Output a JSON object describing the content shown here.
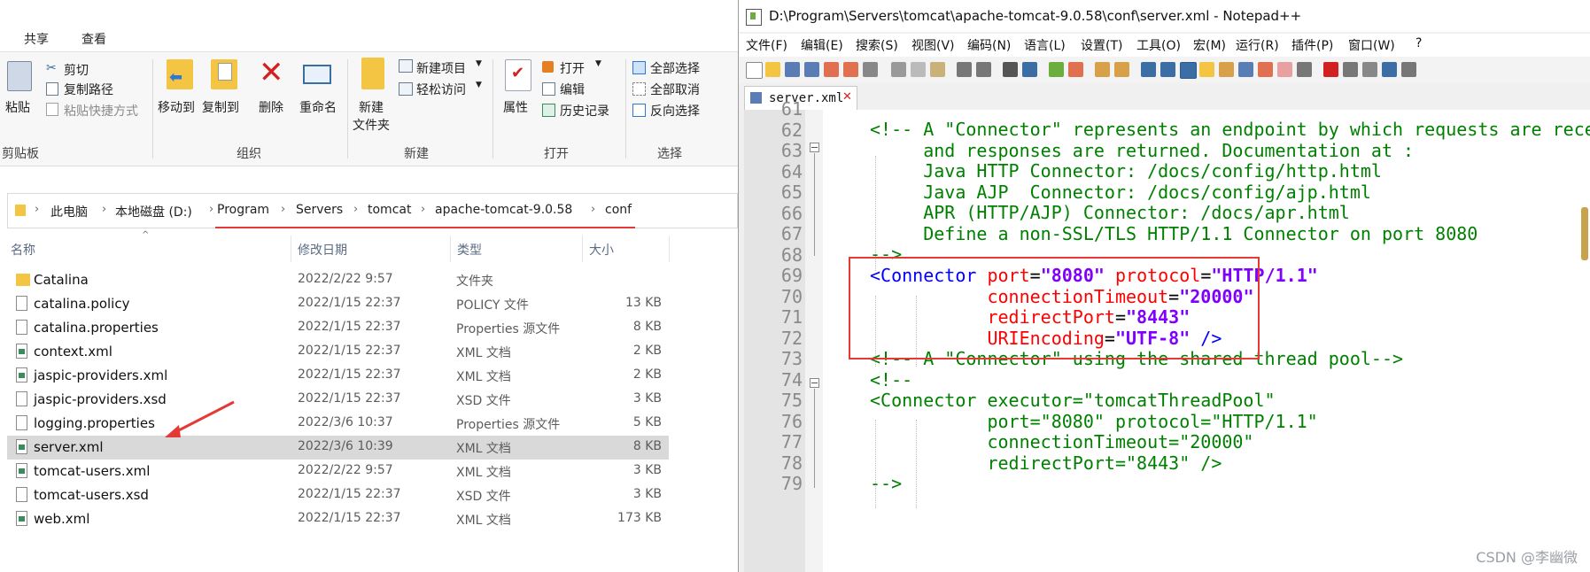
{
  "explorer": {
    "tabs": [
      "共享",
      "查看"
    ],
    "ribbon": {
      "paste": "粘贴",
      "cut": "剪切",
      "copy_path": "复制路径",
      "paste_shortcut": "粘贴快捷方式",
      "clipboard": "剪贴板",
      "move_to": "移动到",
      "copy_to": "复制到",
      "delete": "删除",
      "rename": "重命名",
      "organize": "组织",
      "new_folder_1": "新建",
      "new_folder_2": "文件夹",
      "new_item": "新建项目",
      "easy_access": "轻松访问",
      "new_group": "新建",
      "properties": "属性",
      "open": "打开",
      "edit": "编辑",
      "history": "历史记录",
      "open_group": "打开",
      "select_all": "全部选择",
      "select_none": "全部取消",
      "invert_select": "反向选择",
      "select_group": "选择"
    },
    "breadcrumb": [
      "此电脑",
      "本地磁盘 (D:)",
      "Program",
      "Servers",
      "tomcat",
      "apache-tomcat-9.0.58",
      "conf"
    ],
    "columns": {
      "name": "名称",
      "modified": "修改日期",
      "type": "类型",
      "size": "大小"
    },
    "files": [
      {
        "name": "Catalina",
        "date": "2022/2/22 9:57",
        "type": "文件夹",
        "size": "",
        "icon": "folder-icon"
      },
      {
        "name": "catalina.policy",
        "date": "2022/1/15 22:37",
        "type": "POLICY 文件",
        "size": "13 KB",
        "icon": "file-icon"
      },
      {
        "name": "catalina.properties",
        "date": "2022/1/15 22:37",
        "type": "Properties 源文件",
        "size": "8 KB",
        "icon": "file-icon"
      },
      {
        "name": "context.xml",
        "date": "2022/1/15 22:37",
        "type": "XML 文档",
        "size": "2 KB",
        "icon": "xml-file-icon"
      },
      {
        "name": "jaspic-providers.xml",
        "date": "2022/1/15 22:37",
        "type": "XML 文档",
        "size": "2 KB",
        "icon": "xml-file-icon"
      },
      {
        "name": "jaspic-providers.xsd",
        "date": "2022/1/15 22:37",
        "type": "XSD 文件",
        "size": "3 KB",
        "icon": "file-icon"
      },
      {
        "name": "logging.properties",
        "date": "2022/3/6 10:37",
        "type": "Properties 源文件",
        "size": "5 KB",
        "icon": "file-icon"
      },
      {
        "name": "server.xml",
        "date": "2022/3/6 10:39",
        "type": "XML 文档",
        "size": "8 KB",
        "icon": "xml-file-icon"
      },
      {
        "name": "tomcat-users.xml",
        "date": "2022/2/22 9:57",
        "type": "XML 文档",
        "size": "3 KB",
        "icon": "xml-file-icon"
      },
      {
        "name": "tomcat-users.xsd",
        "date": "2022/1/15 22:37",
        "type": "XSD 文件",
        "size": "3 KB",
        "icon": "file-icon"
      },
      {
        "name": "web.xml",
        "date": "2022/1/15 22:37",
        "type": "XML 文档",
        "size": "173 KB",
        "icon": "xml-file-icon"
      }
    ]
  },
  "notepad": {
    "title": "D:\\Program\\Servers\\tomcat\\apache-tomcat-9.0.58\\conf\\server.xml - Notepad++",
    "menus": [
      "文件(F)",
      "编辑(E)",
      "搜索(S)",
      "视图(V)",
      "编码(N)",
      "语言(L)",
      "设置(T)",
      "工具(O)",
      "宏(M)",
      "运行(R)",
      "插件(P)",
      "窗口(W)",
      "?"
    ],
    "tab": "server.xml",
    "line_numbers": [
      "61",
      "62",
      "63",
      "64",
      "65",
      "66",
      "67",
      "68",
      "69",
      "70",
      "71",
      "72",
      "73",
      "74",
      "75",
      "76",
      "77",
      "78",
      "79"
    ],
    "lines": {
      "l62": "<!-- A \"Connector\" represents an endpoint by which requests are received",
      "l63": "     and responses are returned. Documentation at :",
      "l64": "     Java HTTP Connector: /docs/config/http.html",
      "l65": "     Java AJP  Connector: /docs/config/ajp.html",
      "l66": "     APR (HTTP/AJP) Connector: /docs/apr.html",
      "l67": "     Define a non-SSL/TLS HTTP/1.1 Connector on port 8080",
      "l68": "-->",
      "l69_tag": "<Connector",
      "l69_a1": "port",
      "l69_v1": "\"8080\"",
      "l69_a2": "protocol",
      "l69_v2": "\"HTTP/1.1\"",
      "l70_a": "connectionTimeout",
      "l70_v": "\"20000\"",
      "l71_a": "redirectPort",
      "l71_v": "\"8443\"",
      "l72_a": "URIEncoding",
      "l72_v": "\"UTF-8\"",
      "l72_end": " />",
      "l73": "<!-- A \"Connector\" using the shared thread pool-->",
      "l74": "<!--",
      "l75": "<Connector executor=\"tomcatThreadPool\"",
      "l76": "           port=\"8080\" protocol=\"HTTP/1.1\"",
      "l77": "           connectionTimeout=\"20000\"",
      "l78": "           redirectPort=\"8443\" />",
      "l79": "-->"
    }
  },
  "watermark": "CSDN @李幽微"
}
